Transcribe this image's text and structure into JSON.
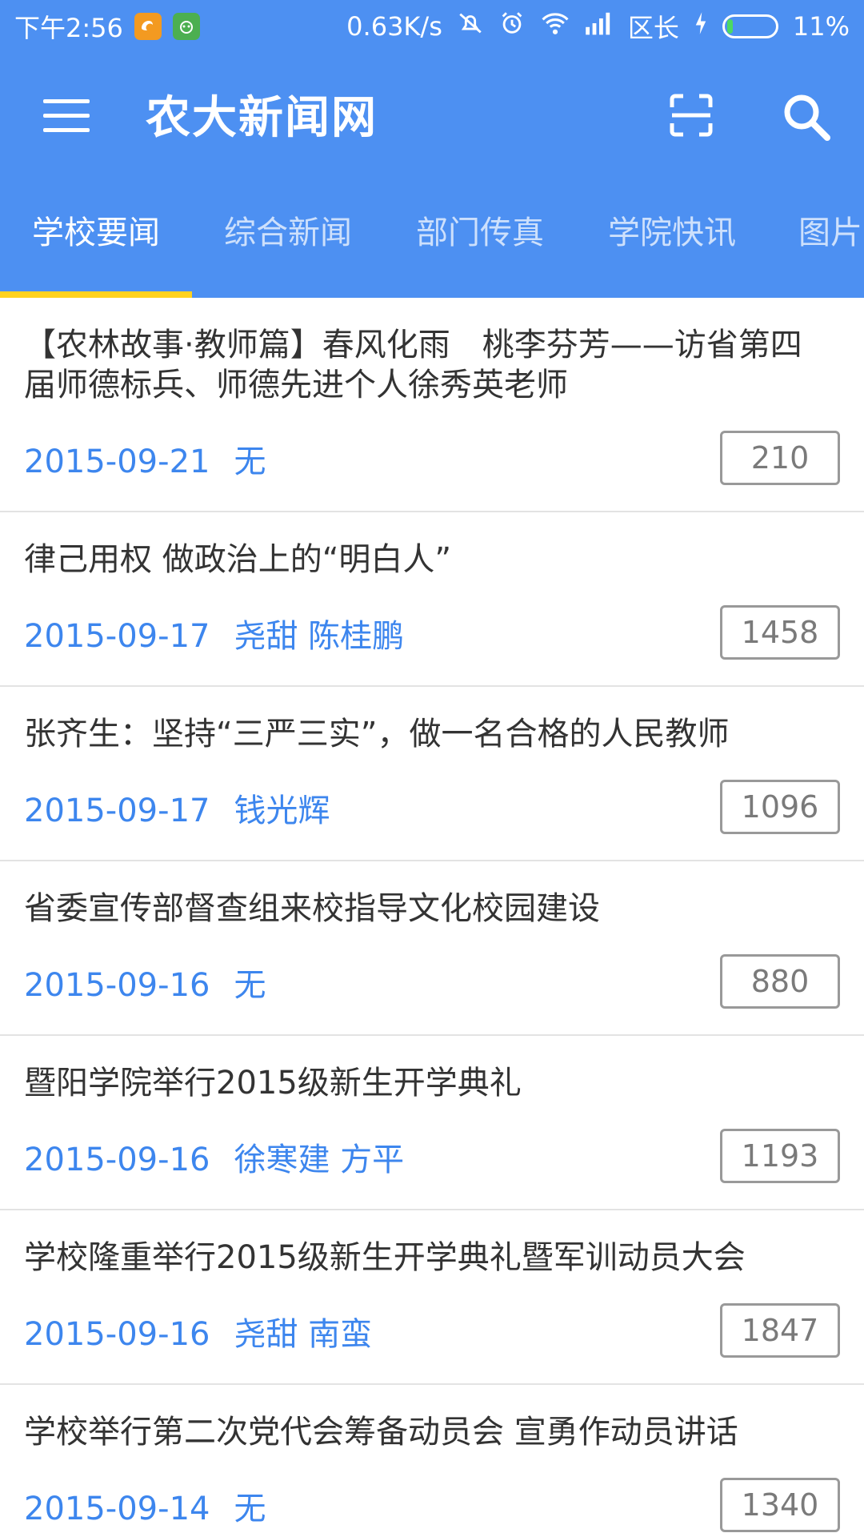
{
  "status_bar": {
    "time": "下午2:56",
    "speed": "0.63K/s",
    "carrier": "区长",
    "battery_percent": "11%",
    "battery_level": 0.11,
    "icons": [
      "uc-browser-icon",
      "android-app-icon",
      "mute-icon",
      "alarm-icon",
      "wifi-icon",
      "signal-icon",
      "charging-icon",
      "battery-icon"
    ]
  },
  "app_bar": {
    "title": "农大新闻网",
    "icons": [
      "menu-icon",
      "scan-icon",
      "search-icon"
    ],
    "color": "#4d90f2"
  },
  "tabs": [
    {
      "label": "学校要闻",
      "active": true
    },
    {
      "label": "综合新闻",
      "active": false
    },
    {
      "label": "部门传真",
      "active": false
    },
    {
      "label": "学院快讯",
      "active": false
    },
    {
      "label": "图片",
      "active": false
    }
  ],
  "accent_colors": {
    "indicator": "#ffd21f",
    "meta_text": "#3d86ee"
  },
  "news": [
    {
      "title": "【农林故事·教师篇】春风化雨　桃李芬芳——访省第四届师德标兵、师德先进个人徐秀英老师",
      "date": "2015-09-21",
      "author": "无",
      "views": "210"
    },
    {
      "title": "律己用权 做政治上的“明白人”",
      "date": "2015-09-17",
      "author": "尧甜 陈桂鹏",
      "views": "1458"
    },
    {
      "title": "张齐生：坚持“三严三实”，做一名合格的人民教师",
      "date": "2015-09-17",
      "author": "钱光辉",
      "views": "1096"
    },
    {
      "title": "省委宣传部督查组来校指导文化校园建设",
      "date": "2015-09-16",
      "author": "无",
      "views": "880"
    },
    {
      "title": "暨阳学院举行2015级新生开学典礼",
      "date": "2015-09-16",
      "author": "徐寒建 方平",
      "views": "1193"
    },
    {
      "title": "学校隆重举行2015级新生开学典礼暨军训动员大会",
      "date": "2015-09-16",
      "author": "尧甜 南蛮",
      "views": "1847"
    },
    {
      "title": "学校举行第二次党代会筹备动员会 宣勇作动员讲话",
      "date": "2015-09-14",
      "author": "无",
      "views": "1340"
    }
  ]
}
